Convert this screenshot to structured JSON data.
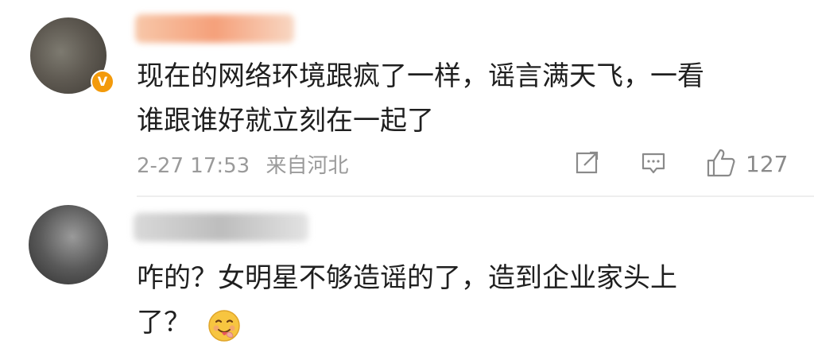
{
  "comments": [
    {
      "verified_badge": "V",
      "text_line1": "现在的网络环境跟疯了一样，谣言满天飞，一看",
      "text_line2": "谁跟谁好就立刻在一起了",
      "date": "2-27 17:53",
      "location": "来自河北",
      "likes": "127"
    },
    {
      "text_line1": "咋的？女明星不够造谣的了，造到企业家头上",
      "text_line2": "了？",
      "emoji": "smiling-face-with-tongue"
    }
  ],
  "colors": {
    "text": "#1f1f1f",
    "meta": "#9a9a9a",
    "badge": "#f39a0b"
  }
}
